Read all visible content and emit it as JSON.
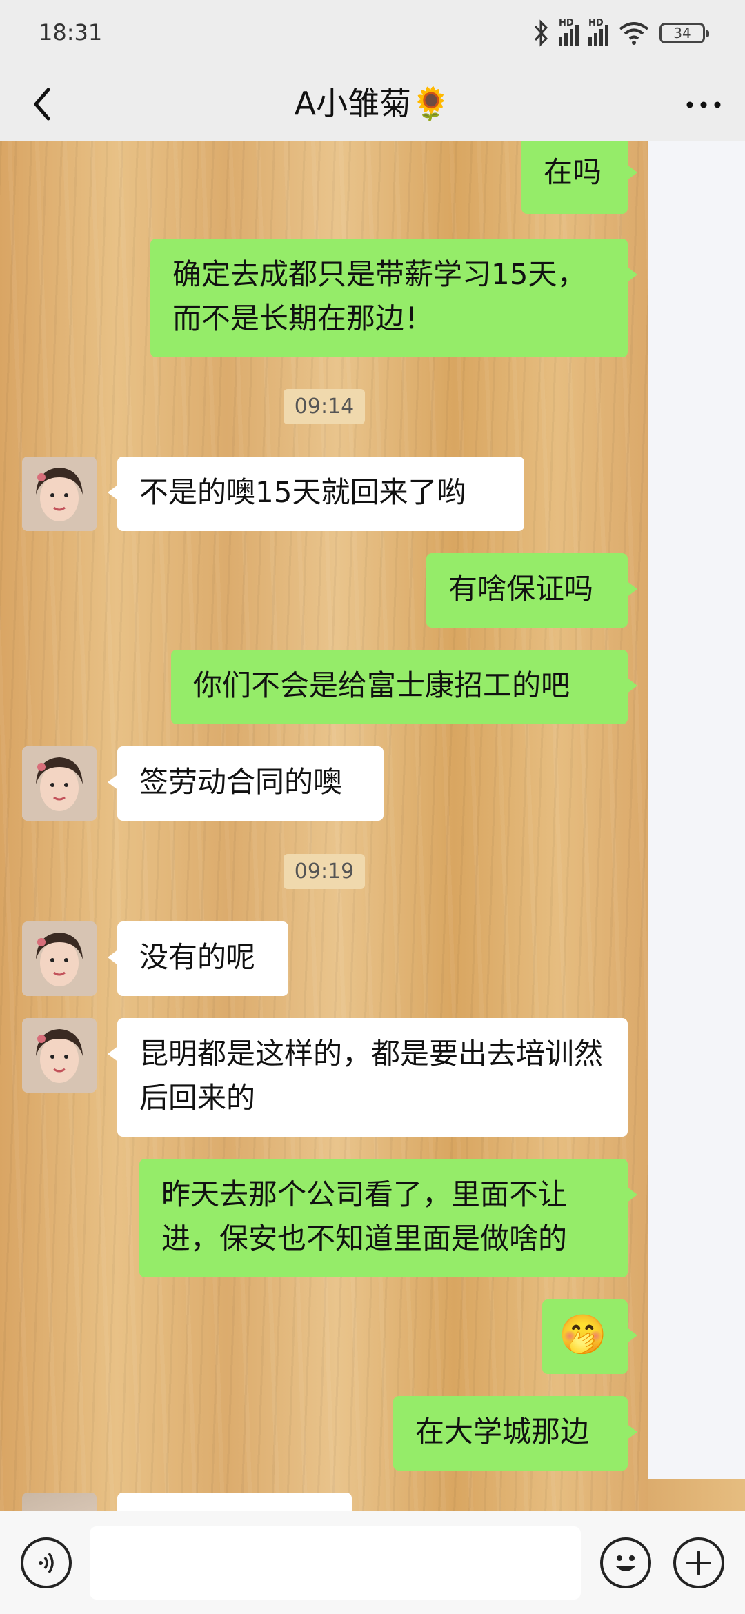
{
  "status": {
    "time": "18:31",
    "battery": "34",
    "net1": "HD",
    "net2": "HD"
  },
  "header": {
    "title": "A小雏菊🌻"
  },
  "messages": [
    {
      "text": "在吗"
    },
    {
      "text": "确定去成都只是带薪学习15天，而不是长期在那边！"
    },
    {
      "timestamp": "09:14"
    },
    {
      "text": "不是的噢15天就回来了哟"
    },
    {
      "text": "有啥保证吗"
    },
    {
      "text": "你们不会是给富士康招工的吧"
    },
    {
      "text": "签劳动合同的噢"
    },
    {
      "timestamp": "09:19"
    },
    {
      "text": "没有的呢"
    },
    {
      "text": "昆明都是这样的，都是要出去培训然后回来的"
    },
    {
      "text": "昨天去那个公司看了，里面不让进，保安也不知道里面是做啥的"
    },
    {
      "text": "🤭"
    },
    {
      "text": "在大学城那边"
    }
  ]
}
